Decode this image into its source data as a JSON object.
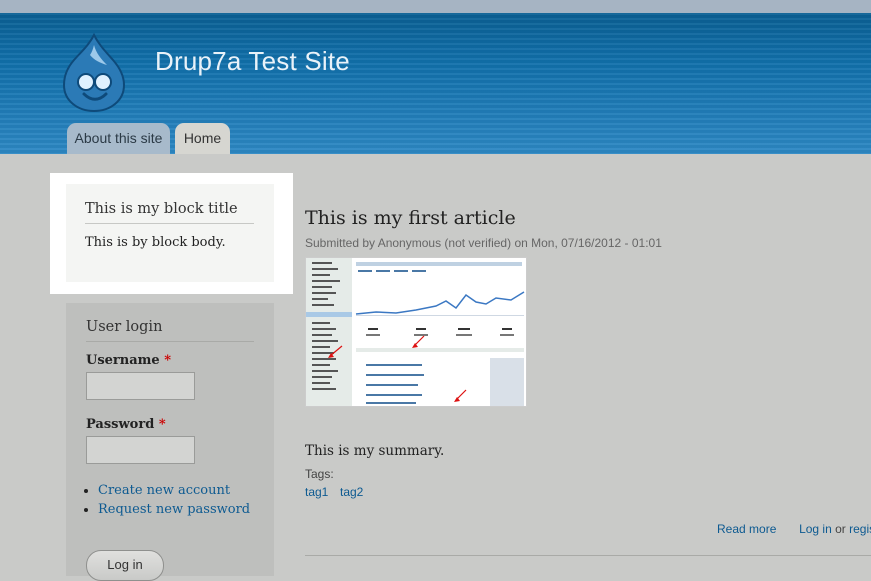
{
  "site": {
    "name": "Drup7a Test Site"
  },
  "nav": {
    "tabs": [
      "About this site",
      "Home"
    ]
  },
  "block": {
    "title": "This is my block title",
    "body": "This is by block body."
  },
  "login": {
    "title": "User login",
    "username_label": "Username",
    "password_label": "Password",
    "required_mark": "*",
    "username_value": "",
    "password_value": "",
    "links": [
      "Create new account",
      "Request new password"
    ],
    "button": "Log in"
  },
  "article": {
    "title": "This is my first article",
    "submitted": "Submitted by Anonymous (not verified) on Mon, 07/16/2012 - 01:01",
    "summary": "This is my summary.",
    "tags_label": "Tags:",
    "tags": [
      "tag1",
      "tag2"
    ],
    "read_more": "Read more",
    "login_link": "Log in",
    "or_text": "or",
    "register_link": "register"
  }
}
